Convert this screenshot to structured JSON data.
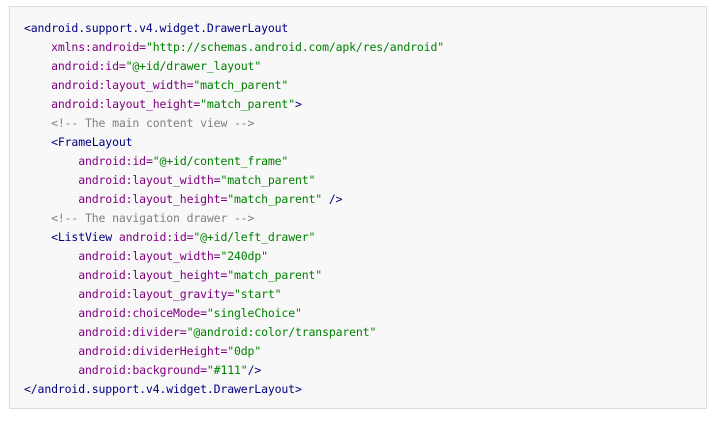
{
  "code": {
    "lines": [
      {
        "indent": 0,
        "tokens": [
          {
            "t": "tag",
            "v": "<android.support.v4.widget.DrawerLayout"
          }
        ]
      },
      {
        "indent": 1,
        "tokens": [
          {
            "t": "attr",
            "v": "xmlns:android="
          },
          {
            "t": "val",
            "v": "\"http://schemas.android.com/apk/res/android\""
          }
        ]
      },
      {
        "indent": 1,
        "tokens": [
          {
            "t": "attr",
            "v": "android:id="
          },
          {
            "t": "val",
            "v": "\"@+id/drawer_layout\""
          }
        ]
      },
      {
        "indent": 1,
        "tokens": [
          {
            "t": "attr",
            "v": "android:layout_width="
          },
          {
            "t": "val",
            "v": "\"match_parent\""
          }
        ]
      },
      {
        "indent": 1,
        "tokens": [
          {
            "t": "attr",
            "v": "android:layout_height="
          },
          {
            "t": "val",
            "v": "\"match_parent\""
          },
          {
            "t": "punct",
            "v": ">"
          }
        ]
      },
      {
        "indent": 1,
        "tokens": [
          {
            "t": "comment",
            "v": "<!-- The main content view -->"
          }
        ]
      },
      {
        "indent": 1,
        "tokens": [
          {
            "t": "tag",
            "v": "<FrameLayout"
          }
        ]
      },
      {
        "indent": 2,
        "tokens": [
          {
            "t": "attr",
            "v": "android:id="
          },
          {
            "t": "val",
            "v": "\"@+id/content_frame\""
          }
        ]
      },
      {
        "indent": 2,
        "tokens": [
          {
            "t": "attr",
            "v": "android:layout_width="
          },
          {
            "t": "val",
            "v": "\"match_parent\""
          }
        ]
      },
      {
        "indent": 2,
        "tokens": [
          {
            "t": "attr",
            "v": "android:layout_height="
          },
          {
            "t": "val",
            "v": "\"match_parent\""
          },
          {
            "t": "punct",
            "v": " />"
          }
        ]
      },
      {
        "indent": 1,
        "tokens": [
          {
            "t": "comment",
            "v": "<!-- The navigation drawer -->"
          }
        ]
      },
      {
        "indent": 1,
        "tokens": [
          {
            "t": "tag",
            "v": "<ListView "
          },
          {
            "t": "attr",
            "v": "android:id="
          },
          {
            "t": "val",
            "v": "\"@+id/left_drawer\""
          }
        ]
      },
      {
        "indent": 2,
        "tokens": [
          {
            "t": "attr",
            "v": "android:layout_width="
          },
          {
            "t": "val",
            "v": "\"240dp\""
          }
        ]
      },
      {
        "indent": 2,
        "tokens": [
          {
            "t": "attr",
            "v": "android:layout_height="
          },
          {
            "t": "val",
            "v": "\"match_parent\""
          }
        ]
      },
      {
        "indent": 2,
        "tokens": [
          {
            "t": "attr",
            "v": "android:layout_gravity="
          },
          {
            "t": "val",
            "v": "\"start\""
          }
        ]
      },
      {
        "indent": 2,
        "tokens": [
          {
            "t": "attr",
            "v": "android:choiceMode="
          },
          {
            "t": "val",
            "v": "\"singleChoice\""
          }
        ]
      },
      {
        "indent": 2,
        "tokens": [
          {
            "t": "attr",
            "v": "android:divider="
          },
          {
            "t": "val",
            "v": "\"@android:color/transparent\""
          }
        ]
      },
      {
        "indent": 2,
        "tokens": [
          {
            "t": "attr",
            "v": "android:dividerHeight="
          },
          {
            "t": "val",
            "v": "\"0dp\""
          }
        ]
      },
      {
        "indent": 2,
        "tokens": [
          {
            "t": "attr",
            "v": "android:background="
          },
          {
            "t": "val",
            "v": "\"#111\""
          },
          {
            "t": "punct",
            "v": "/>"
          }
        ]
      },
      {
        "indent": 0,
        "tokens": [
          {
            "t": "tag",
            "v": "</android.support.v4.widget.DrawerLayout>"
          }
        ]
      }
    ]
  },
  "colors": {
    "tag": "#000080",
    "attribute": "#800080",
    "value": "#008000",
    "comment": "#808080",
    "background": "#f8f8f8",
    "border": "#dcdcdc"
  }
}
